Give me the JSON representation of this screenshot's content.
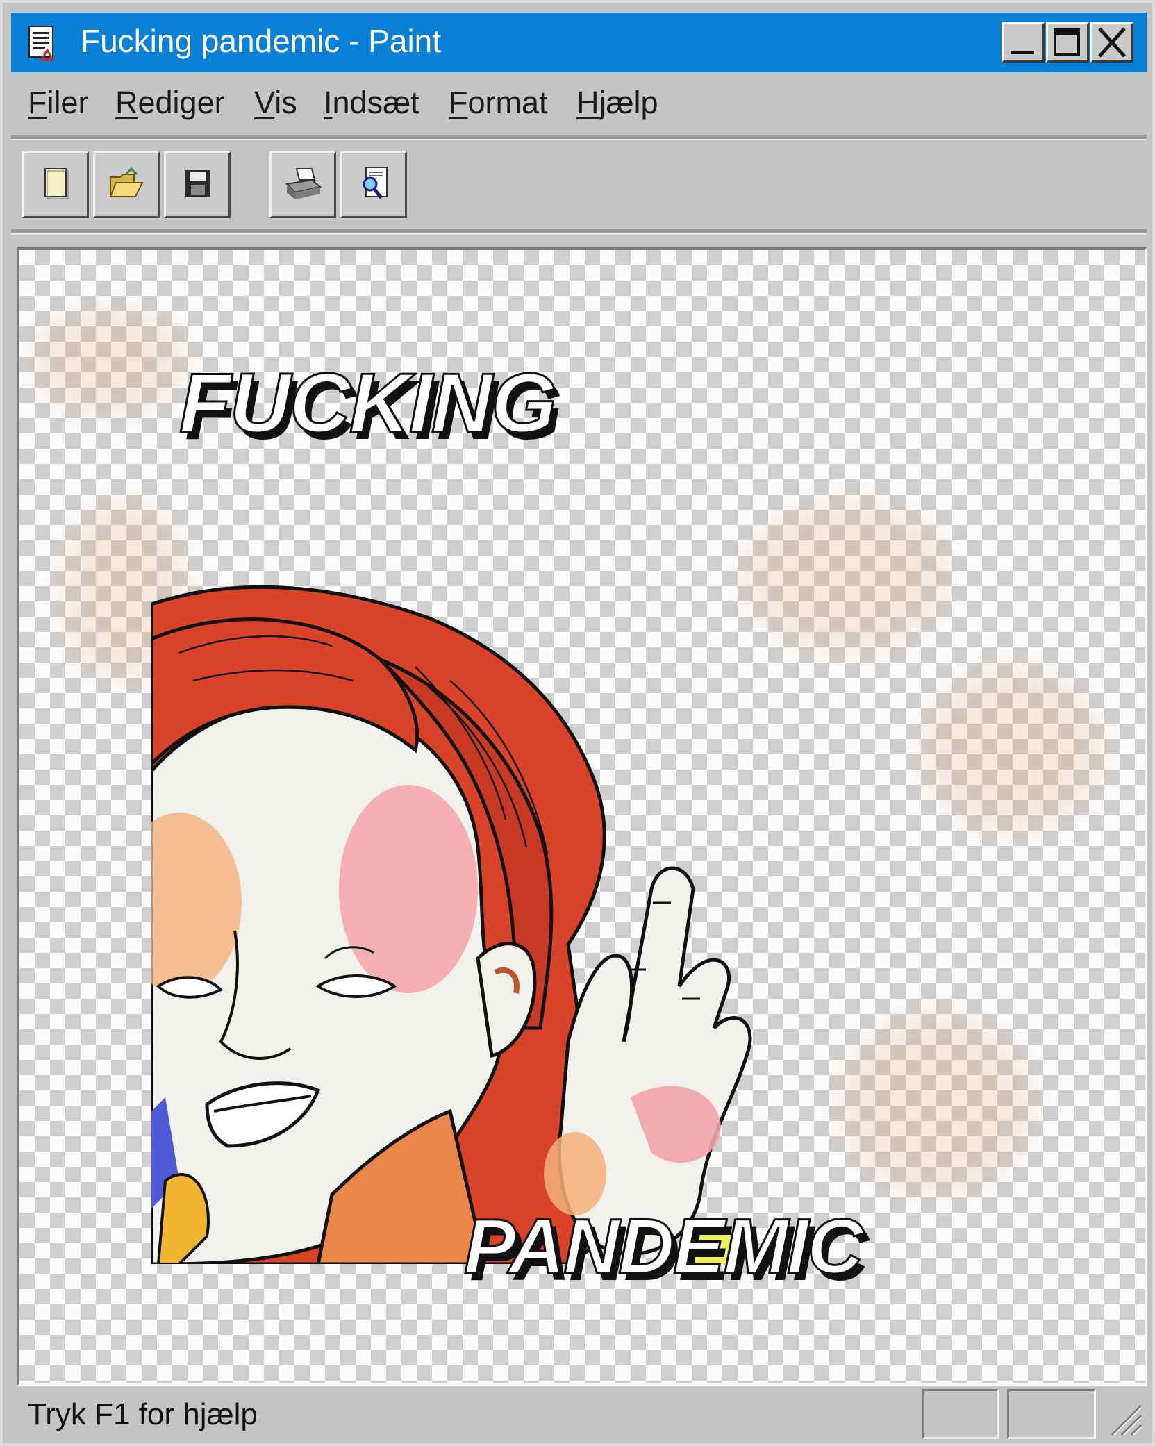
{
  "window": {
    "title": "Fucking pandemic - Paint",
    "titlebar_color": "#0a7fd6",
    "controls": {
      "minimize": "minimize-icon",
      "maximize": "maximize-icon",
      "close": "close-icon"
    }
  },
  "menu": {
    "items": [
      {
        "label": "Filer",
        "key": "F",
        "rest": "iler"
      },
      {
        "label": "Rediger",
        "key": "R",
        "rest": "ediger"
      },
      {
        "label": "Vis",
        "key": "V",
        "rest": "is"
      },
      {
        "label": "Indsæt",
        "key": "I",
        "rest": "ndsæt"
      },
      {
        "label": "Format",
        "key": "F",
        "rest": "ormat"
      },
      {
        "label": "Hjælp",
        "key": "H",
        "rest": "jælp"
      }
    ]
  },
  "toolbar": {
    "buttons": [
      {
        "name": "new-button",
        "icon": "new-document-icon"
      },
      {
        "name": "open-button",
        "icon": "open-folder-icon"
      },
      {
        "name": "save-button",
        "icon": "floppy-disk-icon"
      },
      {
        "name": "print-button",
        "icon": "printer-icon"
      },
      {
        "name": "print-preview-button",
        "icon": "print-preview-icon"
      }
    ]
  },
  "canvas": {
    "headline_top": "FUCKING",
    "headline_bottom": "PANDEMIC",
    "hair_color": "#d8432a",
    "skin_blush_color": "#f2a3a6"
  },
  "status": {
    "text": "Tryk F1 for hjælp"
  }
}
